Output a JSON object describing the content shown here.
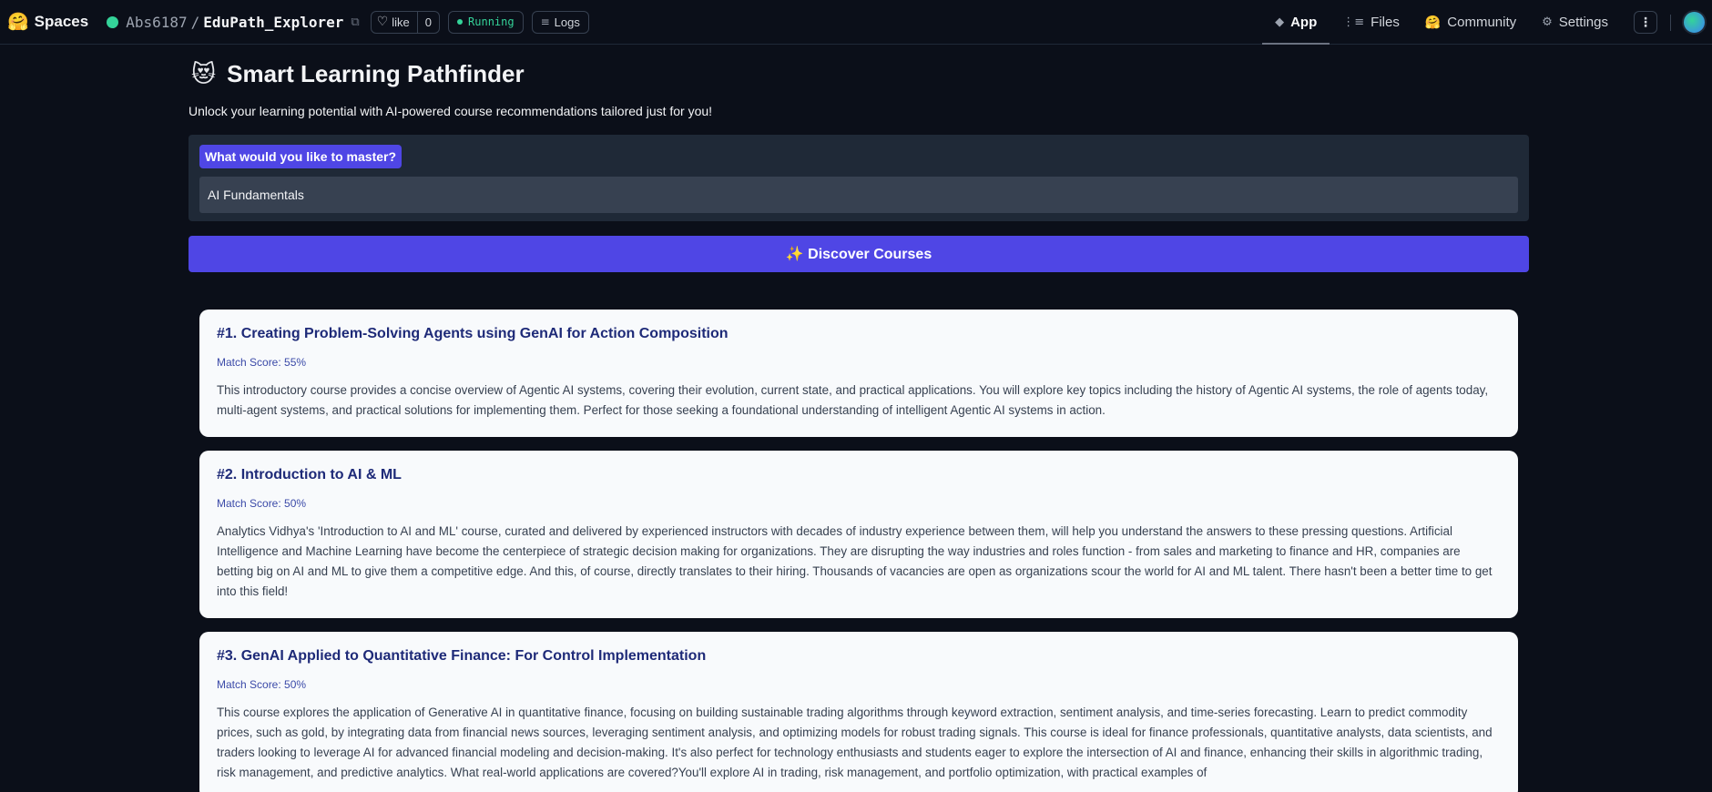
{
  "header": {
    "spaces_label": "Spaces",
    "owner": "Abs6187",
    "separator": "/",
    "repo_name": "EduPath_Explorer",
    "like_label": "like",
    "like_count": "0",
    "status_label": "Running",
    "logs_label": "Logs",
    "nav": [
      {
        "label": "App",
        "icon": "app-icon",
        "active": true
      },
      {
        "label": "Files",
        "icon": "files-icon",
        "active": false
      },
      {
        "label": "Community",
        "icon": "community-icon",
        "active": false
      },
      {
        "label": "Settings",
        "icon": "gear-icon",
        "active": false
      }
    ]
  },
  "app": {
    "title_emoji": "😻",
    "title": "Smart Learning Pathfinder",
    "subtitle": "Unlock your learning potential with AI-powered course recommendations tailored just for you!",
    "input_label": "What would you like to master?",
    "input_value": "AI Fundamentals",
    "button_label": "✨ Discover Courses"
  },
  "results": [
    {
      "title": "#1. Creating Problem-Solving Agents using GenAI for Action Composition",
      "score": "Match Score: 55%",
      "description": "This introductory course provides a concise overview of Agentic AI systems, covering their evolution, current state, and practical applications. You will explore key topics including the history of Agentic AI systems, the role of agents today, multi-agent systems, and practical solutions for implementing them. Perfect for those seeking a foundational understanding of intelligent Agentic AI systems in action."
    },
    {
      "title": "#2. Introduction to AI & ML",
      "score": "Match Score: 50%",
      "description": "Analytics Vidhya's 'Introduction to AI and ML' course, curated and delivered by experienced instructors with decades of industry experience between them, will help you understand the answers to these pressing questions. Artificial Intelligence and Machine Learning have become the centerpiece of strategic decision making for organizations. They are disrupting the way industries and roles function - from sales and marketing to finance and HR, companies are betting big on AI and ML to give them a competitive edge. And this, of course, directly translates to their hiring. Thousands of vacancies are open as organizations scour the world for AI and ML talent. There hasn't been a better time to get into this field!"
    },
    {
      "title": "#3. GenAI Applied to Quantitative Finance: For Control Implementation",
      "score": "Match Score: 50%",
      "description": "This course explores the application of Generative AI in quantitative finance, focusing on building sustainable trading algorithms through keyword extraction, sentiment analysis, and time-series forecasting. Learn to predict commodity prices, such as gold, by integrating data from financial news sources, leveraging sentiment analysis, and optimizing models for robust trading signals. This course is ideal for finance professionals, quantitative analysts, data scientists, and traders looking to leverage AI for advanced financial modeling and decision-making. It's also perfect for technology enthusiasts and students eager to explore the intersection of AI and finance, enhancing their skills in algorithmic trading, risk management, and predictive analytics. What real-world applications are covered?You'll explore AI in trading, risk management, and portfolio optimization, with practical examples of"
    }
  ]
}
